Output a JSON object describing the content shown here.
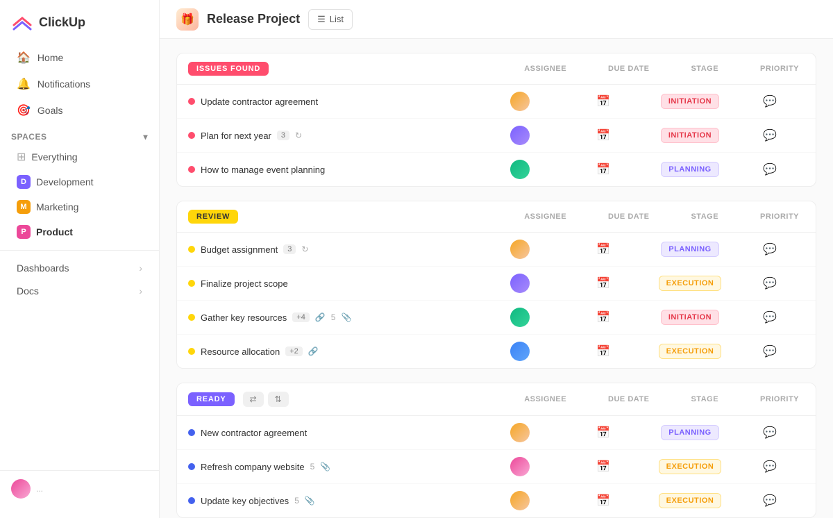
{
  "app": {
    "name": "ClickUp"
  },
  "sidebar": {
    "nav": [
      {
        "id": "home",
        "label": "Home",
        "icon": "🏠"
      },
      {
        "id": "notifications",
        "label": "Notifications",
        "icon": "🔔"
      },
      {
        "id": "goals",
        "label": "Goals",
        "icon": "🎯"
      }
    ],
    "spaces_label": "Spaces",
    "spaces": [
      {
        "id": "everything",
        "label": "Everything",
        "icon": "⊞",
        "type": "grid"
      },
      {
        "id": "development",
        "label": "Development",
        "color": "#7b61ff",
        "initial": "D"
      },
      {
        "id": "marketing",
        "label": "Marketing",
        "color": "#f59e0b",
        "initial": "M"
      },
      {
        "id": "product",
        "label": "Product",
        "color": "#ec4899",
        "initial": "P",
        "active": true
      }
    ],
    "bottom_nav": [
      {
        "id": "dashboards",
        "label": "Dashboards"
      },
      {
        "id": "docs",
        "label": "Docs"
      }
    ]
  },
  "header": {
    "project_title": "Release Project",
    "view_label": "List"
  },
  "sections": [
    {
      "id": "issues-found",
      "badge_label": "ISSUES FOUND",
      "badge_class": "badge-issues",
      "col_headers": [
        "ASSIGNEE",
        "DUE DATE",
        "STAGE",
        "PRIORITY"
      ],
      "tasks": [
        {
          "name": "Update contractor agreement",
          "dot": "dot-red",
          "stage": "INITIATION",
          "stage_class": "stage-initiation",
          "av": "av1"
        },
        {
          "name": "Plan for next year",
          "dot": "dot-red",
          "count": "3",
          "stage": "INITIATION",
          "stage_class": "stage-initiation",
          "av": "av2"
        },
        {
          "name": "How to manage event planning",
          "dot": "dot-red",
          "stage": "PLANNING",
          "stage_class": "stage-planning",
          "av": "av3"
        }
      ]
    },
    {
      "id": "review",
      "badge_label": "REVIEW",
      "badge_class": "badge-review",
      "col_headers": [
        "ASSIGNEE",
        "DUE DATE",
        "STAGE",
        "PRIORITY"
      ],
      "tasks": [
        {
          "name": "Budget assignment",
          "dot": "dot-yellow",
          "count": "3",
          "stage": "PLANNING",
          "stage_class": "stage-planning",
          "av": "av1"
        },
        {
          "name": "Finalize project scope",
          "dot": "dot-yellow",
          "stage": "EXECUTION",
          "stage_class": "stage-execution",
          "av": "av2"
        },
        {
          "name": "Gather key resources",
          "dot": "dot-yellow",
          "extra": "+4",
          "attachments": "5",
          "stage": "INITIATION",
          "stage_class": "stage-initiation",
          "av": "av3"
        },
        {
          "name": "Resource allocation",
          "dot": "dot-yellow",
          "extra": "+2",
          "stage": "EXECUTION",
          "stage_class": "stage-execution",
          "av": "av4"
        }
      ]
    },
    {
      "id": "ready",
      "badge_label": "READY",
      "badge_class": "badge-ready",
      "col_headers": [
        "ASSIGNEE",
        "DUE DATE",
        "STAGE",
        "PRIORITY"
      ],
      "tasks": [
        {
          "name": "New contractor agreement",
          "dot": "dot-blue",
          "stage": "PLANNING",
          "stage_class": "stage-planning",
          "av": "av1"
        },
        {
          "name": "Refresh company website",
          "dot": "dot-blue",
          "attachments": "5",
          "stage": "EXECUTION",
          "stage_class": "stage-execution",
          "av": "av5"
        },
        {
          "name": "Update key objectives",
          "dot": "dot-blue",
          "attachments": "5",
          "stage": "EXECUTION",
          "stage_class": "stage-execution",
          "av": "av1"
        }
      ]
    }
  ]
}
